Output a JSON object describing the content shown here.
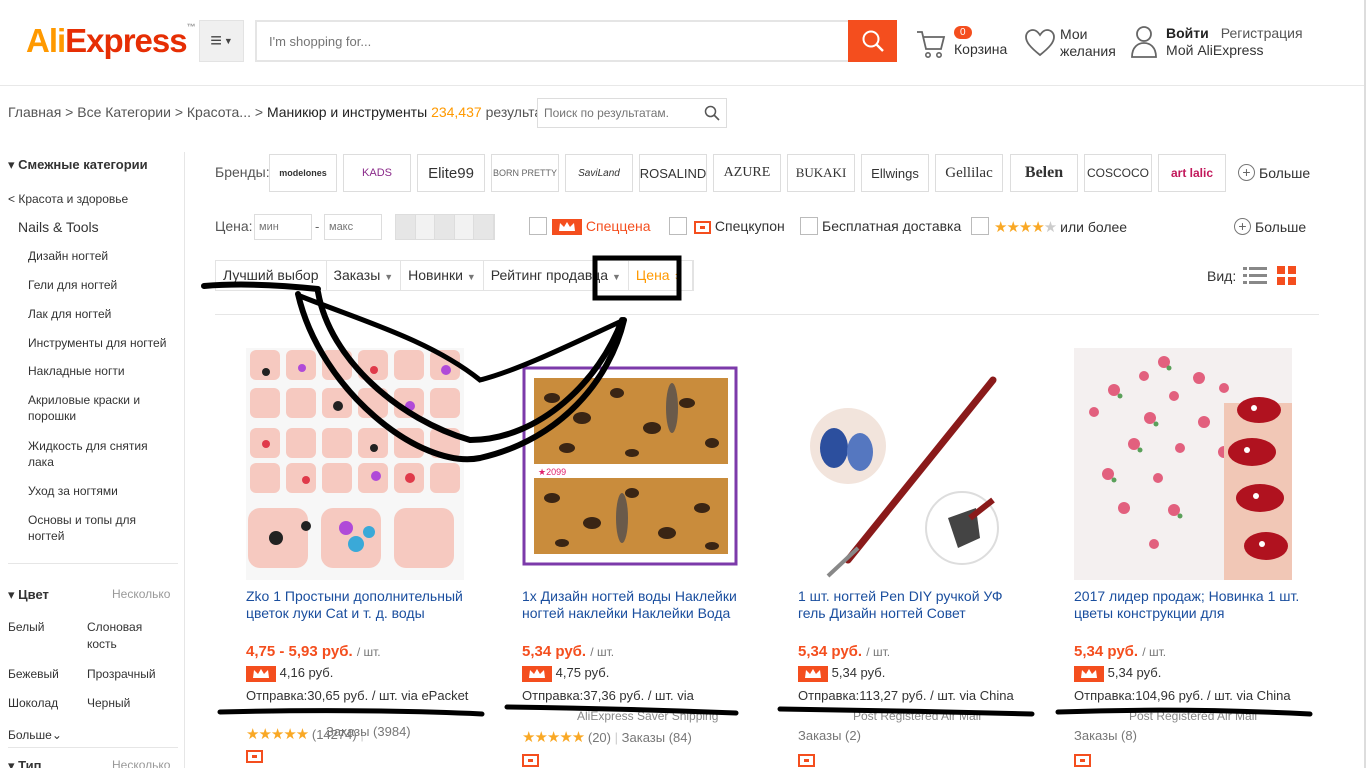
{
  "header": {
    "logo": "AliExpress",
    "search_placeholder": "I'm shopping for...",
    "cart_count": "0",
    "cart_label": "Корзина",
    "wishlist_line1": "Мои",
    "wishlist_line2": "желания",
    "signin": "Войти",
    "register": "Регистрация",
    "my_account": "Мой AliExpress"
  },
  "breadcrumb": {
    "path": "Главная > Все Категории > Красота... > ",
    "current": "Маникюр и инструменты",
    "count": "234,437",
    "results": "результатов",
    "refine_placeholder": "Поиск по результатам."
  },
  "sidebar": {
    "related_title": "Смежные категории",
    "parent": "< Красота и здоровье",
    "group": "Nails & Tools",
    "items": [
      "Дизайн ногтей",
      "Гели для ногтей",
      "Лак для ногтей",
      "Инструменты для ногтей",
      "Накладные ногти",
      "Акриловые краски и порошки",
      "Жидкость для снятия лака",
      "Уход за ногтями",
      "Основы и топы для ногтей"
    ],
    "color_title": "Цвет",
    "color_hint": "Несколько",
    "colors": [
      "Белый",
      "Слоновая кость",
      "Бежевый",
      "Прозрачный",
      "Шоколад",
      "Черный"
    ],
    "more_colors": "Больше",
    "type_title": "Тип",
    "type_hint": "Несколько"
  },
  "brands": {
    "label": "Бренды:",
    "items": [
      "modelones",
      "KADS",
      "Elite99",
      "BORN PRETTY",
      "SaviLand",
      "ROSALIND",
      "AZURE",
      "BUKAKI",
      "Ellwings",
      "Gellilac",
      "Belen",
      "COSCOCO",
      "art lalic"
    ],
    "more": "Больше"
  },
  "filters": {
    "price_label": "Цена:",
    "min_placeholder": "мин",
    "max_placeholder": "макс",
    "special_price": "Спеццена",
    "special_coupon": "Спецкупон",
    "free_shipping": "Бесплатная доставка",
    "rating_or_more": "или более",
    "more": "Больше"
  },
  "sort": {
    "best": "Лучший выбор",
    "orders": "Заказы",
    "new": "Новинки",
    "seller_rating": "Рейтинг продавца",
    "price": "Цена",
    "view_label": "Вид:"
  },
  "products": [
    {
      "title": "Zko 1 Простыни дополнительный цветок луки Cat и т. д. воды",
      "price": "4,75 - 5,93 руб.",
      "unit": "/ шт.",
      "discount_price": "4,16 руб.",
      "shipping": "Отправка:30,65 руб. / шт. via ePacket",
      "shipping2": "",
      "rating_count": "(14274)",
      "orders": "Заказы (3984)"
    },
    {
      "title": "1х Дизайн ногтей воды Наклейки ногтей наклейки Наклейки Вода",
      "price": "5,34 руб.",
      "unit": "/ шт.",
      "discount_price": "4,75 руб.",
      "shipping": "Отправка:37,36 руб. / шт. via",
      "shipping2": "AliExpress Saver Shipping",
      "rating_count": "(20)",
      "orders": "Заказы (84)"
    },
    {
      "title": "1 шт. ногтей Pen DIY ручкой УФ гель Дизайн ногтей Совет",
      "price": "5,34 руб.",
      "unit": "/ шт.",
      "discount_price": "5,34 руб.",
      "shipping": "Отправка:113,27 руб. / шт. via China",
      "shipping2": "Post Registered Air Mail",
      "rating_count": "",
      "orders": "Заказы (2)"
    },
    {
      "title": "2017 лидер продаж; Новинка 1 шт. цветы конструкции для",
      "price": "5,34 руб.",
      "unit": "/ шт.",
      "discount_price": "5,34 руб.",
      "shipping": "Отправка:104,96 руб. / шт. via China",
      "shipping2": "Post Registered Air Mail",
      "rating_count": "",
      "orders": "Заказы (8)"
    }
  ],
  "colors": {
    "accent": "#f44e1e",
    "logo_orange": "#f90",
    "link_blue": "#1a4e9e"
  }
}
